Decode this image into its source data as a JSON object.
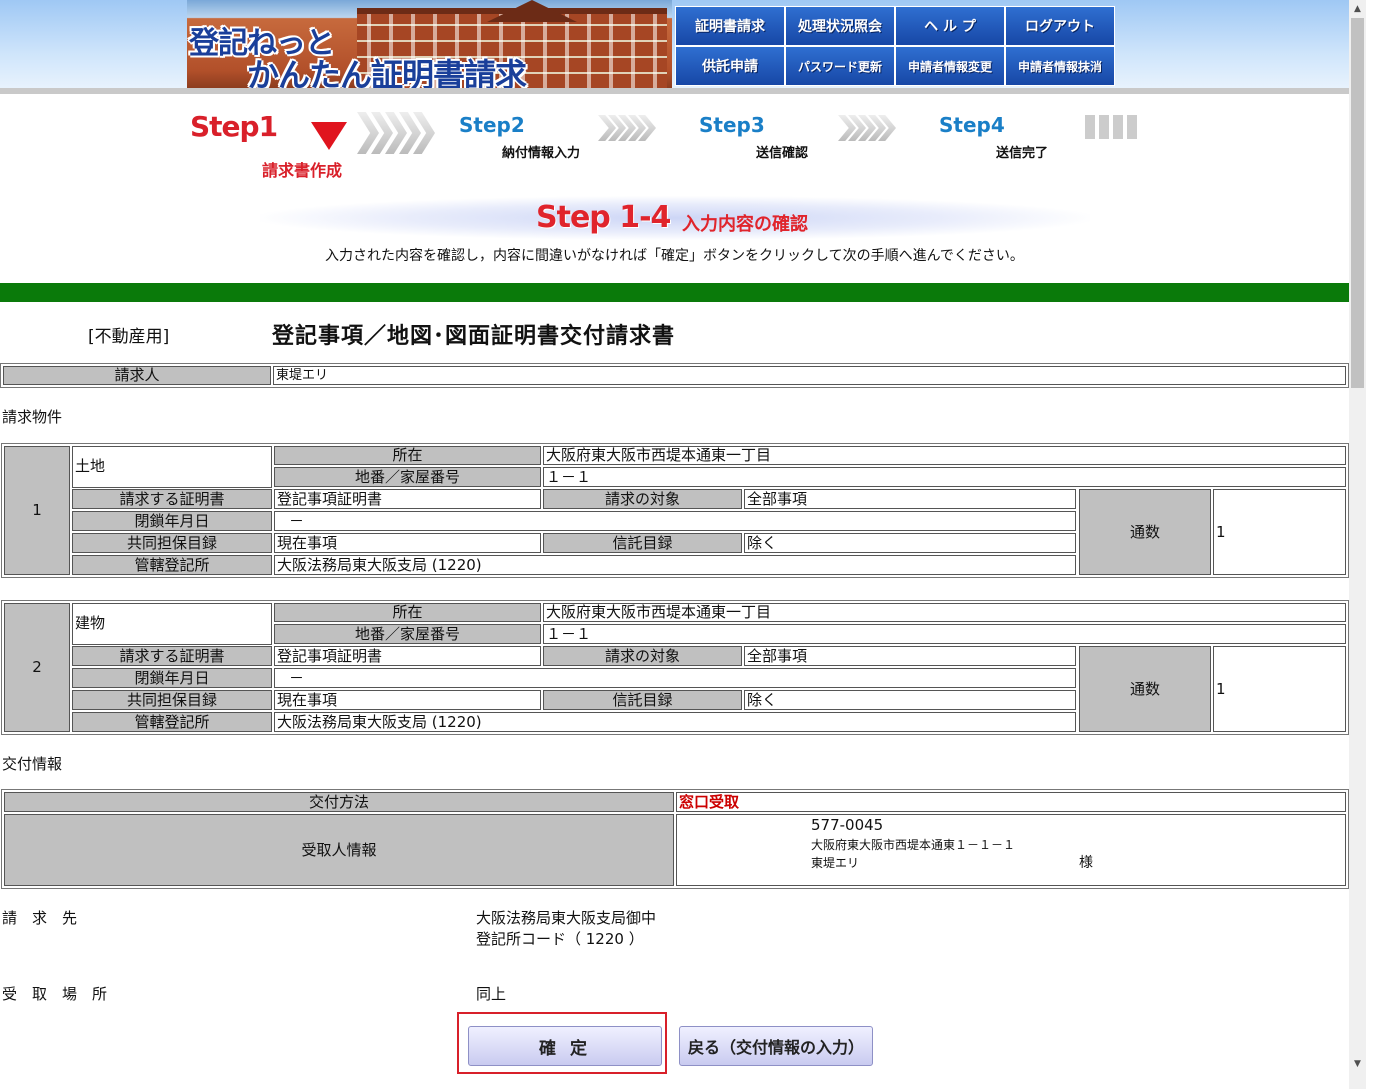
{
  "header": {
    "logo_line1": "登記ねっと",
    "logo_line2": "かんたん証明書請求",
    "nav": [
      {
        "label": "証明書請求"
      },
      {
        "label": "処理状況照会"
      },
      {
        "label": "ヘ ル プ"
      },
      {
        "label": "ログアウト"
      },
      {
        "label": "供託申請"
      },
      {
        "label": "パスワード更新"
      },
      {
        "label": "申請者情報変更"
      },
      {
        "label": "申請者情報抹消"
      }
    ]
  },
  "steps": {
    "step1": "Step1",
    "step1_label": "請求書作成",
    "step2": "Step2",
    "step2_label": "納付情報入力",
    "step3": "Step3",
    "step3_label": "送信確認",
    "step4": "Step4",
    "step4_label": "送信完了"
  },
  "section": {
    "title": "Step 1-4",
    "subtitle": "入力内容の確認",
    "instruction": "入力された内容を確認し，内容に間違いがなければ「確定」ボタンをクリックして次の手順へ進んでください。"
  },
  "form": {
    "type": "[不動産用]",
    "title": "登記事項／地図･図面証明書交付請求書",
    "requester_label": "請求人",
    "requester_value": "東堤エリ",
    "properties_heading": "請求物件",
    "labels": {
      "location": "所在",
      "lot_number": "地番／家屋番号",
      "certificate": "請求する証明書",
      "target": "請求の対象",
      "closed_date": "閉鎖年月日",
      "joint_collateral": "共同担保目録",
      "trust": "信託目録",
      "jurisdiction": "管轄登記所",
      "copies": "通数"
    },
    "items": [
      {
        "no": "1",
        "kind": "土地",
        "location": "大阪府東大阪市西堤本通東一丁目",
        "lot_number": "１－１",
        "certificate": "登記事項証明書",
        "target": "全部事項",
        "closed_date": "－",
        "joint_collateral": "現在事項",
        "trust": "除く",
        "jurisdiction": "大阪法務局東大阪支局 (1220)",
        "copies": "1"
      },
      {
        "no": "2",
        "kind": "建物",
        "location": "大阪府東大阪市西堤本通東一丁目",
        "lot_number": "１－１",
        "certificate": "登記事項証明書",
        "target": "全部事項",
        "closed_date": "－",
        "joint_collateral": "現在事項",
        "trust": "除く",
        "jurisdiction": "大阪法務局東大阪支局 (1220)",
        "copies": "1"
      }
    ],
    "delivery_heading": "交付情報",
    "delivery_method_label": "交付方法",
    "delivery_method_value": "窓口受取",
    "recipient_label": "受取人情報",
    "recipient_zip": "577-0045",
    "recipient_address": "大阪府東大阪市西堤本通東１－１－１",
    "recipient_name": "東堤エリ",
    "recipient_honorific": "様",
    "dest_label": "請　求　先",
    "dest_value1": "大阪法務局東大阪支局御中",
    "dest_value2": "登記所コード（ 1220 ）",
    "pickup_label": "受　取　場　所",
    "pickup_value": "同上"
  },
  "buttons": {
    "confirm": "確 定",
    "back": "戻る（交付情報の入力）"
  }
}
